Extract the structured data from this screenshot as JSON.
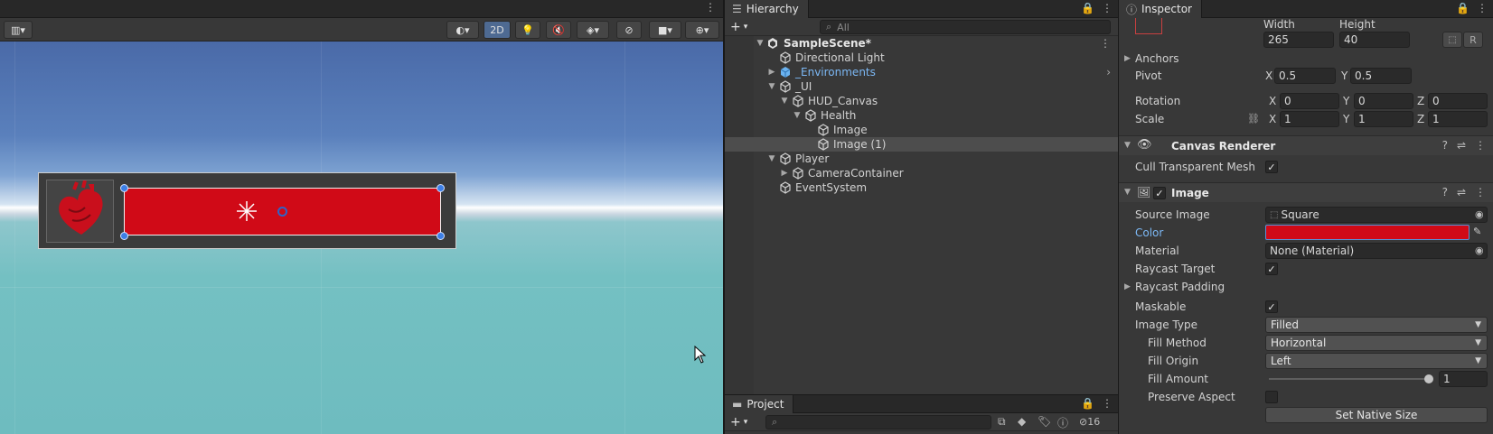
{
  "scene": {
    "toolbar": {
      "button_2d": "2D"
    }
  },
  "hierarchy": {
    "tab_label": "Hierarchy",
    "search_placeholder": "All",
    "items": [
      {
        "label": "SampleScene*",
        "depth": 0,
        "expanded": true,
        "bold": true
      },
      {
        "label": "Directional Light",
        "depth": 1
      },
      {
        "label": "_Environments",
        "depth": 1,
        "collapsed": true,
        "prefab": true
      },
      {
        "label": "_UI",
        "depth": 1,
        "expanded": true
      },
      {
        "label": "HUD_Canvas",
        "depth": 2,
        "expanded": true
      },
      {
        "label": "Health",
        "depth": 3,
        "expanded": true
      },
      {
        "label": "Image",
        "depth": 4
      },
      {
        "label": "Image (1)",
        "depth": 4,
        "selected": true
      },
      {
        "label": "Player",
        "depth": 1,
        "expanded": true
      },
      {
        "label": "CameraContainer",
        "depth": 2,
        "collapsed": true
      },
      {
        "label": "EventSystem",
        "depth": 1
      }
    ]
  },
  "project": {
    "tab_label": "Project",
    "hidden_count": "16"
  },
  "inspector": {
    "tab_label": "Inspector",
    "rect": {
      "width_label": "Width",
      "height_label": "Height",
      "width_value": "265",
      "height_value": "40",
      "raw_label": "R",
      "anchors_label": "Anchors",
      "pivot_label": "Pivot",
      "pivot_x": "0.5",
      "pivot_y": "0.5",
      "rotation_label": "Rotation",
      "rot_x": "0",
      "rot_y": "0",
      "rot_z": "0",
      "scale_label": "Scale",
      "scale_x": "1",
      "scale_y": "1",
      "scale_z": "1",
      "axis_x": "X",
      "axis_y": "Y",
      "axis_z": "Z"
    },
    "canvas_renderer": {
      "title": "Canvas Renderer",
      "cull_label": "Cull Transparent Mesh"
    },
    "image": {
      "title": "Image",
      "source_image_label": "Source Image",
      "source_image_value": "Square",
      "color_label": "Color",
      "color_value": "#d00a17",
      "material_label": "Material",
      "material_value": "None (Material)",
      "raycast_target_label": "Raycast Target",
      "raycast_padding_label": "Raycast Padding",
      "maskable_label": "Maskable",
      "image_type_label": "Image Type",
      "image_type_value": "Filled",
      "fill_method_label": "Fill Method",
      "fill_method_value": "Horizontal",
      "fill_origin_label": "Fill Origin",
      "fill_origin_value": "Left",
      "fill_amount_label": "Fill Amount",
      "fill_amount_value": "1",
      "preserve_aspect_label": "Preserve Aspect",
      "set_native_size_label": "Set Native Size"
    }
  }
}
